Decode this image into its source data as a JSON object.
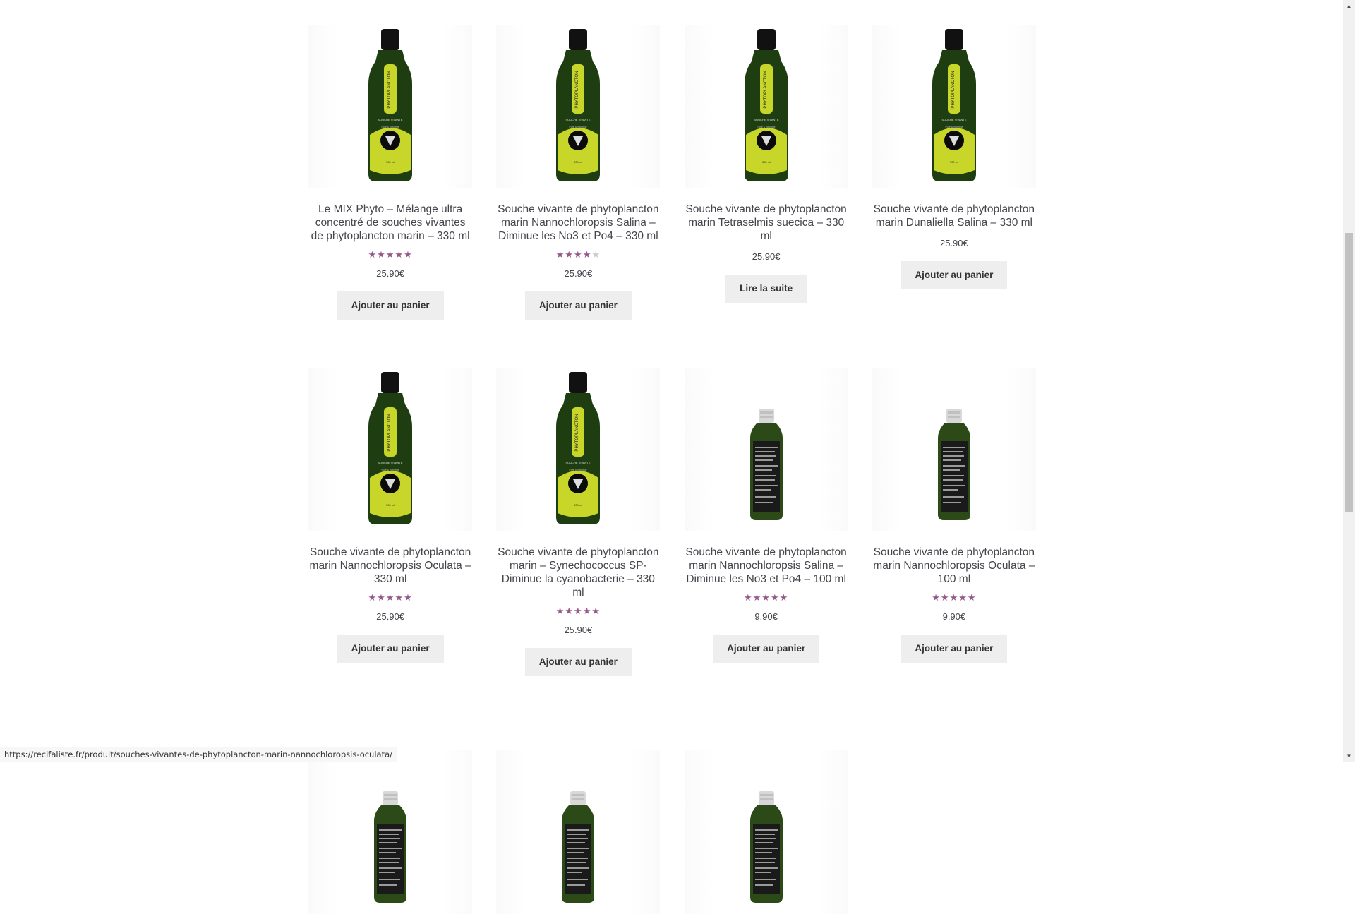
{
  "products_row1": [
    {
      "title": "Le MIX Phyto – Mélange ultra concentré de souches vivantes de phytoplancton marin – 330 ml",
      "rating": 5,
      "price": "25.90€",
      "button": "Ajouter au panier",
      "bottle": "330ml"
    },
    {
      "title": "Souche vivante de phytoplancton marin Nannochloropsis Salina – Diminue les No3 et Po4 – 330 ml",
      "rating": 4,
      "price": "25.90€",
      "button": "Ajouter au panier",
      "bottle": "330ml"
    },
    {
      "title": "Souche vivante de phytoplancton marin Tetraselmis suecica – 330 ml",
      "rating": 0,
      "price": "25.90€",
      "button": "Lire la suite",
      "bottle": "330ml"
    },
    {
      "title": "Souche vivante de phytoplancton marin Dunaliella Salina – 330 ml",
      "rating": 0,
      "price": "25.90€",
      "button": "Ajouter au panier",
      "bottle": "330ml"
    }
  ],
  "products_row2": [
    {
      "title": "Souche vivante de phytoplancton marin Nannochloropsis Oculata – 330 ml",
      "rating": 5,
      "price": "25.90€",
      "button": "Ajouter au panier",
      "bottle": "330ml"
    },
    {
      "title": "Souche vivante de phytoplancton marin – Synechococcus SP- Diminue la cyanobacterie – 330 ml",
      "rating": 4.8,
      "price": "25.90€",
      "button": "Ajouter au panier",
      "bottle": "330ml"
    },
    {
      "title": "Souche vivante de phytoplancton marin Nannochloropsis Salina – Diminue les No3 et Po4 – 100 ml",
      "rating": 5,
      "price": "9.90€",
      "button": "Ajouter au panier",
      "bottle": "100ml"
    },
    {
      "title": "Souche vivante de phytoplancton marin Nannochloropsis Oculata – 100 ml",
      "rating": 5,
      "price": "9.90€",
      "button": "Ajouter au panier",
      "bottle": "100ml"
    }
  ],
  "products_row3": [
    {
      "title": "",
      "rating": 0,
      "price": "",
      "button": "",
      "bottle": "100ml"
    },
    {
      "title": "",
      "rating": 0,
      "price": "",
      "button": "",
      "bottle": "100ml"
    },
    {
      "title": "",
      "rating": 0,
      "price": "",
      "button": "",
      "bottle": "100ml"
    }
  ],
  "bottle_label_330": {
    "brand": "PHYTOPLANCTON",
    "line1": "SOUCHE VIVANTE",
    "line2": "Pure & naturelle",
    "volume": "330 ml"
  },
  "status_url": "https://recifaliste.fr/produit/souches-vivantes-de-phytoplancton-marin-nannochloropsis-oculata/",
  "colors": {
    "star": "#96588a",
    "button_bg": "#eeeeee",
    "bottle_green": "#1e3d10",
    "label_yellow": "#c8d62a"
  }
}
